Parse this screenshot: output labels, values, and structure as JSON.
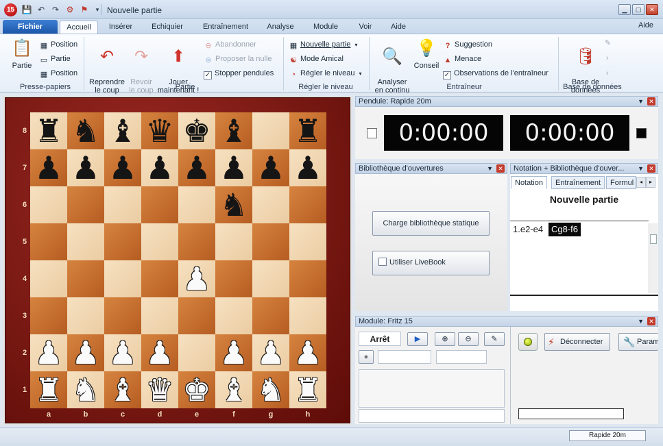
{
  "app": {
    "logo": "15",
    "title": "Nouvelle partie"
  },
  "quick_access": [
    "save-icon",
    "undo-icon",
    "redo-icon",
    "engine-icon",
    "flag-icon",
    "customize-dropdown-icon"
  ],
  "file_tab": "Fichier",
  "tabs": [
    "Accueil",
    "Insérer",
    "Echiquier",
    "Entraînement",
    "Analyse",
    "Module",
    "Voir",
    "Aide"
  ],
  "active_tab": "Accueil",
  "help_link": "Aide",
  "ribbon": {
    "clipboard": {
      "paste_label": "Partie",
      "items": [
        "Position",
        "Partie",
        "Position"
      ],
      "group": "Presse-papiers"
    },
    "game": {
      "takeback": "Reprendre\nle coup",
      "replay": "Revoir\nle coup",
      "play_now": "Jouer\nmaintenant !",
      "resign": "Abandonner",
      "offer_draw": "Proposer la nulle",
      "stop_clocks": "Stopper pendules",
      "group": "Partie"
    },
    "level": {
      "new_game": "Nouvelle partie",
      "friendly": "Mode Amical",
      "set_level": "Régler le niveau",
      "group": "Régler le niveau"
    },
    "trainer": {
      "analyze": "Analyser\nen continu",
      "advice": "Conseil",
      "hint": "Suggestion",
      "threat": "Menace",
      "coach": "Observations de l'entraîneur",
      "group": "Entraîneur"
    },
    "database": {
      "db": "Base de\ndonnées",
      "group": "Base de données"
    }
  },
  "board": {
    "ranks": [
      "8",
      "7",
      "6",
      "5",
      "4",
      "3",
      "2",
      "1"
    ],
    "files": [
      "a",
      "b",
      "c",
      "d",
      "e",
      "f",
      "g",
      "h"
    ],
    "position": [
      "r n b q k b . r",
      "p p p p p p p p",
      ". . . . . n . .",
      ". . . . . . . .",
      ". . . . P . . .",
      ". . . . . . . .",
      "P P P P . P P P",
      "R N B Q K B N R"
    ]
  },
  "clock_pane": {
    "title": "Pendule: Rapide 20m",
    "white": "0:00:00",
    "black": "0:00:00"
  },
  "book_pane": {
    "title": "Bibliothèque d'ouvertures",
    "load_button": "Charge bibliothèque statique",
    "livebook": "Utiliser LiveBook"
  },
  "notation_pane": {
    "title": "Notation + Bibliothèque d'ouver...",
    "tabs": [
      "Notation",
      "Entraînement",
      "Formul"
    ],
    "heading": "Nouvelle partie",
    "moves": [
      "1.e2-e4",
      "Cg8-f6"
    ]
  },
  "engine_pane": {
    "title": "Module: Fritz 15",
    "status": "Arrêt",
    "disconnect": "Déconnecter",
    "params": "Param"
  },
  "statusbar": {
    "text": "Rapide 20m"
  }
}
